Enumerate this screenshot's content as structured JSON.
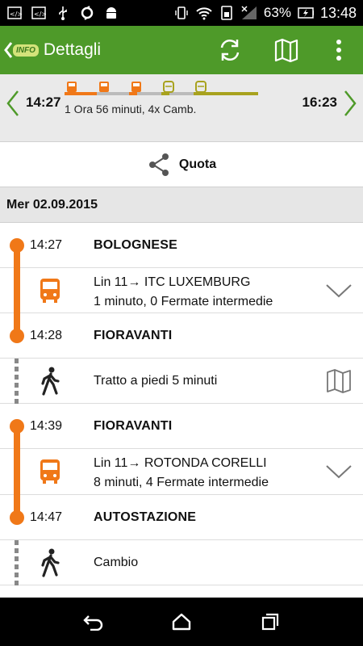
{
  "status_bar": {
    "battery": "63%",
    "time": "13:48"
  },
  "app_bar": {
    "logo": "INFO",
    "title": "Dettagli",
    "icons": [
      "refresh-icon",
      "map-icon",
      "overflow-menu-icon"
    ]
  },
  "summary": {
    "start_time": "14:27",
    "end_time": "16:23",
    "duration_text": "1 Ora 56 minuti, 4x Camb."
  },
  "share": {
    "label": "Quota"
  },
  "date": "Mer 02.09.2015",
  "legs": [
    {
      "type": "bus",
      "from_time": "14:27",
      "from_stop": "BOLOGNESE",
      "line": "Lin 11→ ITC LUXEMBURG",
      "details": "1 minuto, 0 Fermate intermedie",
      "to_time": "14:28",
      "to_stop": "FIORAVANTI"
    },
    {
      "type": "walk",
      "text": "Tratto a piedi 5 minuti"
    },
    {
      "type": "bus",
      "from_time": "14:39",
      "from_stop": "FIORAVANTI",
      "line": "Lin 11→ ROTONDA CORELLI",
      "details": "8 minuti, 4 Fermate intermedie",
      "to_time": "14:47",
      "to_stop": "AUTOSTAZIONE"
    },
    {
      "type": "walk",
      "text": "Cambio"
    }
  ],
  "colors": {
    "app_bar": "#4e9a29",
    "timeline": "#f07818",
    "bus_icon": "#f07818",
    "train_icon": "#a8a21e"
  }
}
